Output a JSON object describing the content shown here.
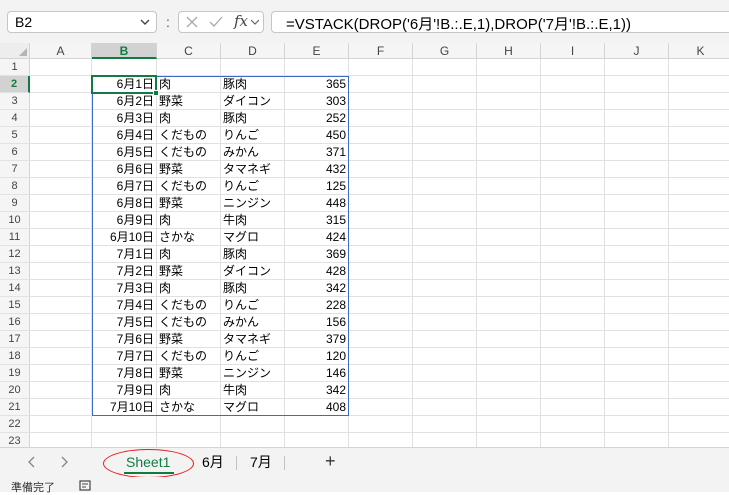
{
  "formula_bar": {
    "name_box": "B2",
    "formula": "=VSTACK(DROP('6月'!B.:.E,1),DROP('7月'!B.:.E,1))",
    "fx_label": "fx",
    "separator": ":"
  },
  "columns": [
    "A",
    "B",
    "C",
    "D",
    "E",
    "F",
    "G",
    "H",
    "I",
    "J",
    "K"
  ],
  "rows": [
    "1",
    "2",
    "3",
    "4",
    "5",
    "6",
    "7",
    "8",
    "9",
    "10",
    "11",
    "12",
    "13",
    "14",
    "15",
    "16",
    "17",
    "18",
    "19",
    "20",
    "21",
    "22",
    "23"
  ],
  "selected": {
    "column": "B",
    "row": "2"
  },
  "data_rows": [
    [
      "6月1日",
      "肉",
      "豚肉",
      "365"
    ],
    [
      "6月2日",
      "野菜",
      "ダイコン",
      "303"
    ],
    [
      "6月3日",
      "肉",
      "豚肉",
      "252"
    ],
    [
      "6月4日",
      "くだもの",
      "りんご",
      "450"
    ],
    [
      "6月5日",
      "くだもの",
      "みかん",
      "371"
    ],
    [
      "6月6日",
      "野菜",
      "タマネギ",
      "432"
    ],
    [
      "6月7日",
      "くだもの",
      "りんご",
      "125"
    ],
    [
      "6月8日",
      "野菜",
      "ニンジン",
      "448"
    ],
    [
      "6月9日",
      "肉",
      "牛肉",
      "315"
    ],
    [
      "6月10日",
      "さかな",
      "マグロ",
      "424"
    ],
    [
      "7月1日",
      "肉",
      "豚肉",
      "369"
    ],
    [
      "7月2日",
      "野菜",
      "ダイコン",
      "428"
    ],
    [
      "7月3日",
      "肉",
      "豚肉",
      "342"
    ],
    [
      "7月4日",
      "くだもの",
      "りんご",
      "228"
    ],
    [
      "7月5日",
      "くだもの",
      "みかん",
      "156"
    ],
    [
      "7月6日",
      "野菜",
      "タマネギ",
      "379"
    ],
    [
      "7月7日",
      "くだもの",
      "りんご",
      "120"
    ],
    [
      "7月8日",
      "野菜",
      "ニンジン",
      "146"
    ],
    [
      "7月9日",
      "肉",
      "牛肉",
      "342"
    ],
    [
      "7月10日",
      "さかな",
      "マグロ",
      "408"
    ]
  ],
  "sheet_tabs": [
    {
      "label": "Sheet1",
      "active": true
    },
    {
      "label": "6月",
      "active": false
    },
    {
      "label": "7月",
      "active": false
    }
  ],
  "add_sheet_label": "+",
  "status_bar": {
    "text": "準備完了"
  },
  "colors": {
    "accent_green": "#107c41",
    "spill_border": "#3b6bc4",
    "annotation_red": "#e0201b"
  }
}
